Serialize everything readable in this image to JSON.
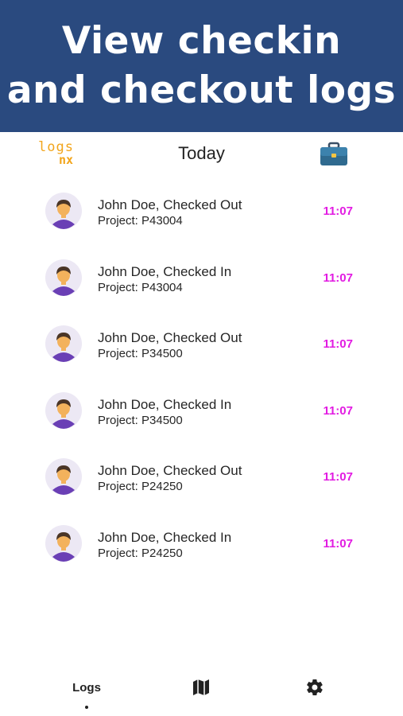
{
  "banner": {
    "line1": "View checkin",
    "line2": "and checkout logs"
  },
  "appbar": {
    "logo_top": "logs",
    "logo_bottom": "nx",
    "title": "Today",
    "right_icon": "briefcase-icon"
  },
  "logs": [
    {
      "title": "John Doe, Checked Out",
      "project": "Project: P43004",
      "time": "11:07"
    },
    {
      "title": "John Doe, Checked In",
      "project": "Project: P43004",
      "time": "11:07"
    },
    {
      "title": "John Doe, Checked Out",
      "project": "Project: P34500",
      "time": "11:07"
    },
    {
      "title": "John Doe, Checked In",
      "project": "Project: P34500",
      "time": "11:07"
    },
    {
      "title": "John Doe, Checked Out",
      "project": "Project: P24250",
      "time": "11:07"
    },
    {
      "title": "John Doe, Checked In",
      "project": "Project: P24250",
      "time": "11:07"
    }
  ],
  "bottom_nav": {
    "logs_label": "Logs",
    "map_icon": "map-icon",
    "settings_icon": "gear-icon"
  },
  "colors": {
    "banner": "#2a4a7f",
    "time_accent": "#e21be2",
    "logo": "#f2a51b",
    "avatar_bg": "#ece8f4",
    "avatar_shirt": "#6a3fb5"
  }
}
